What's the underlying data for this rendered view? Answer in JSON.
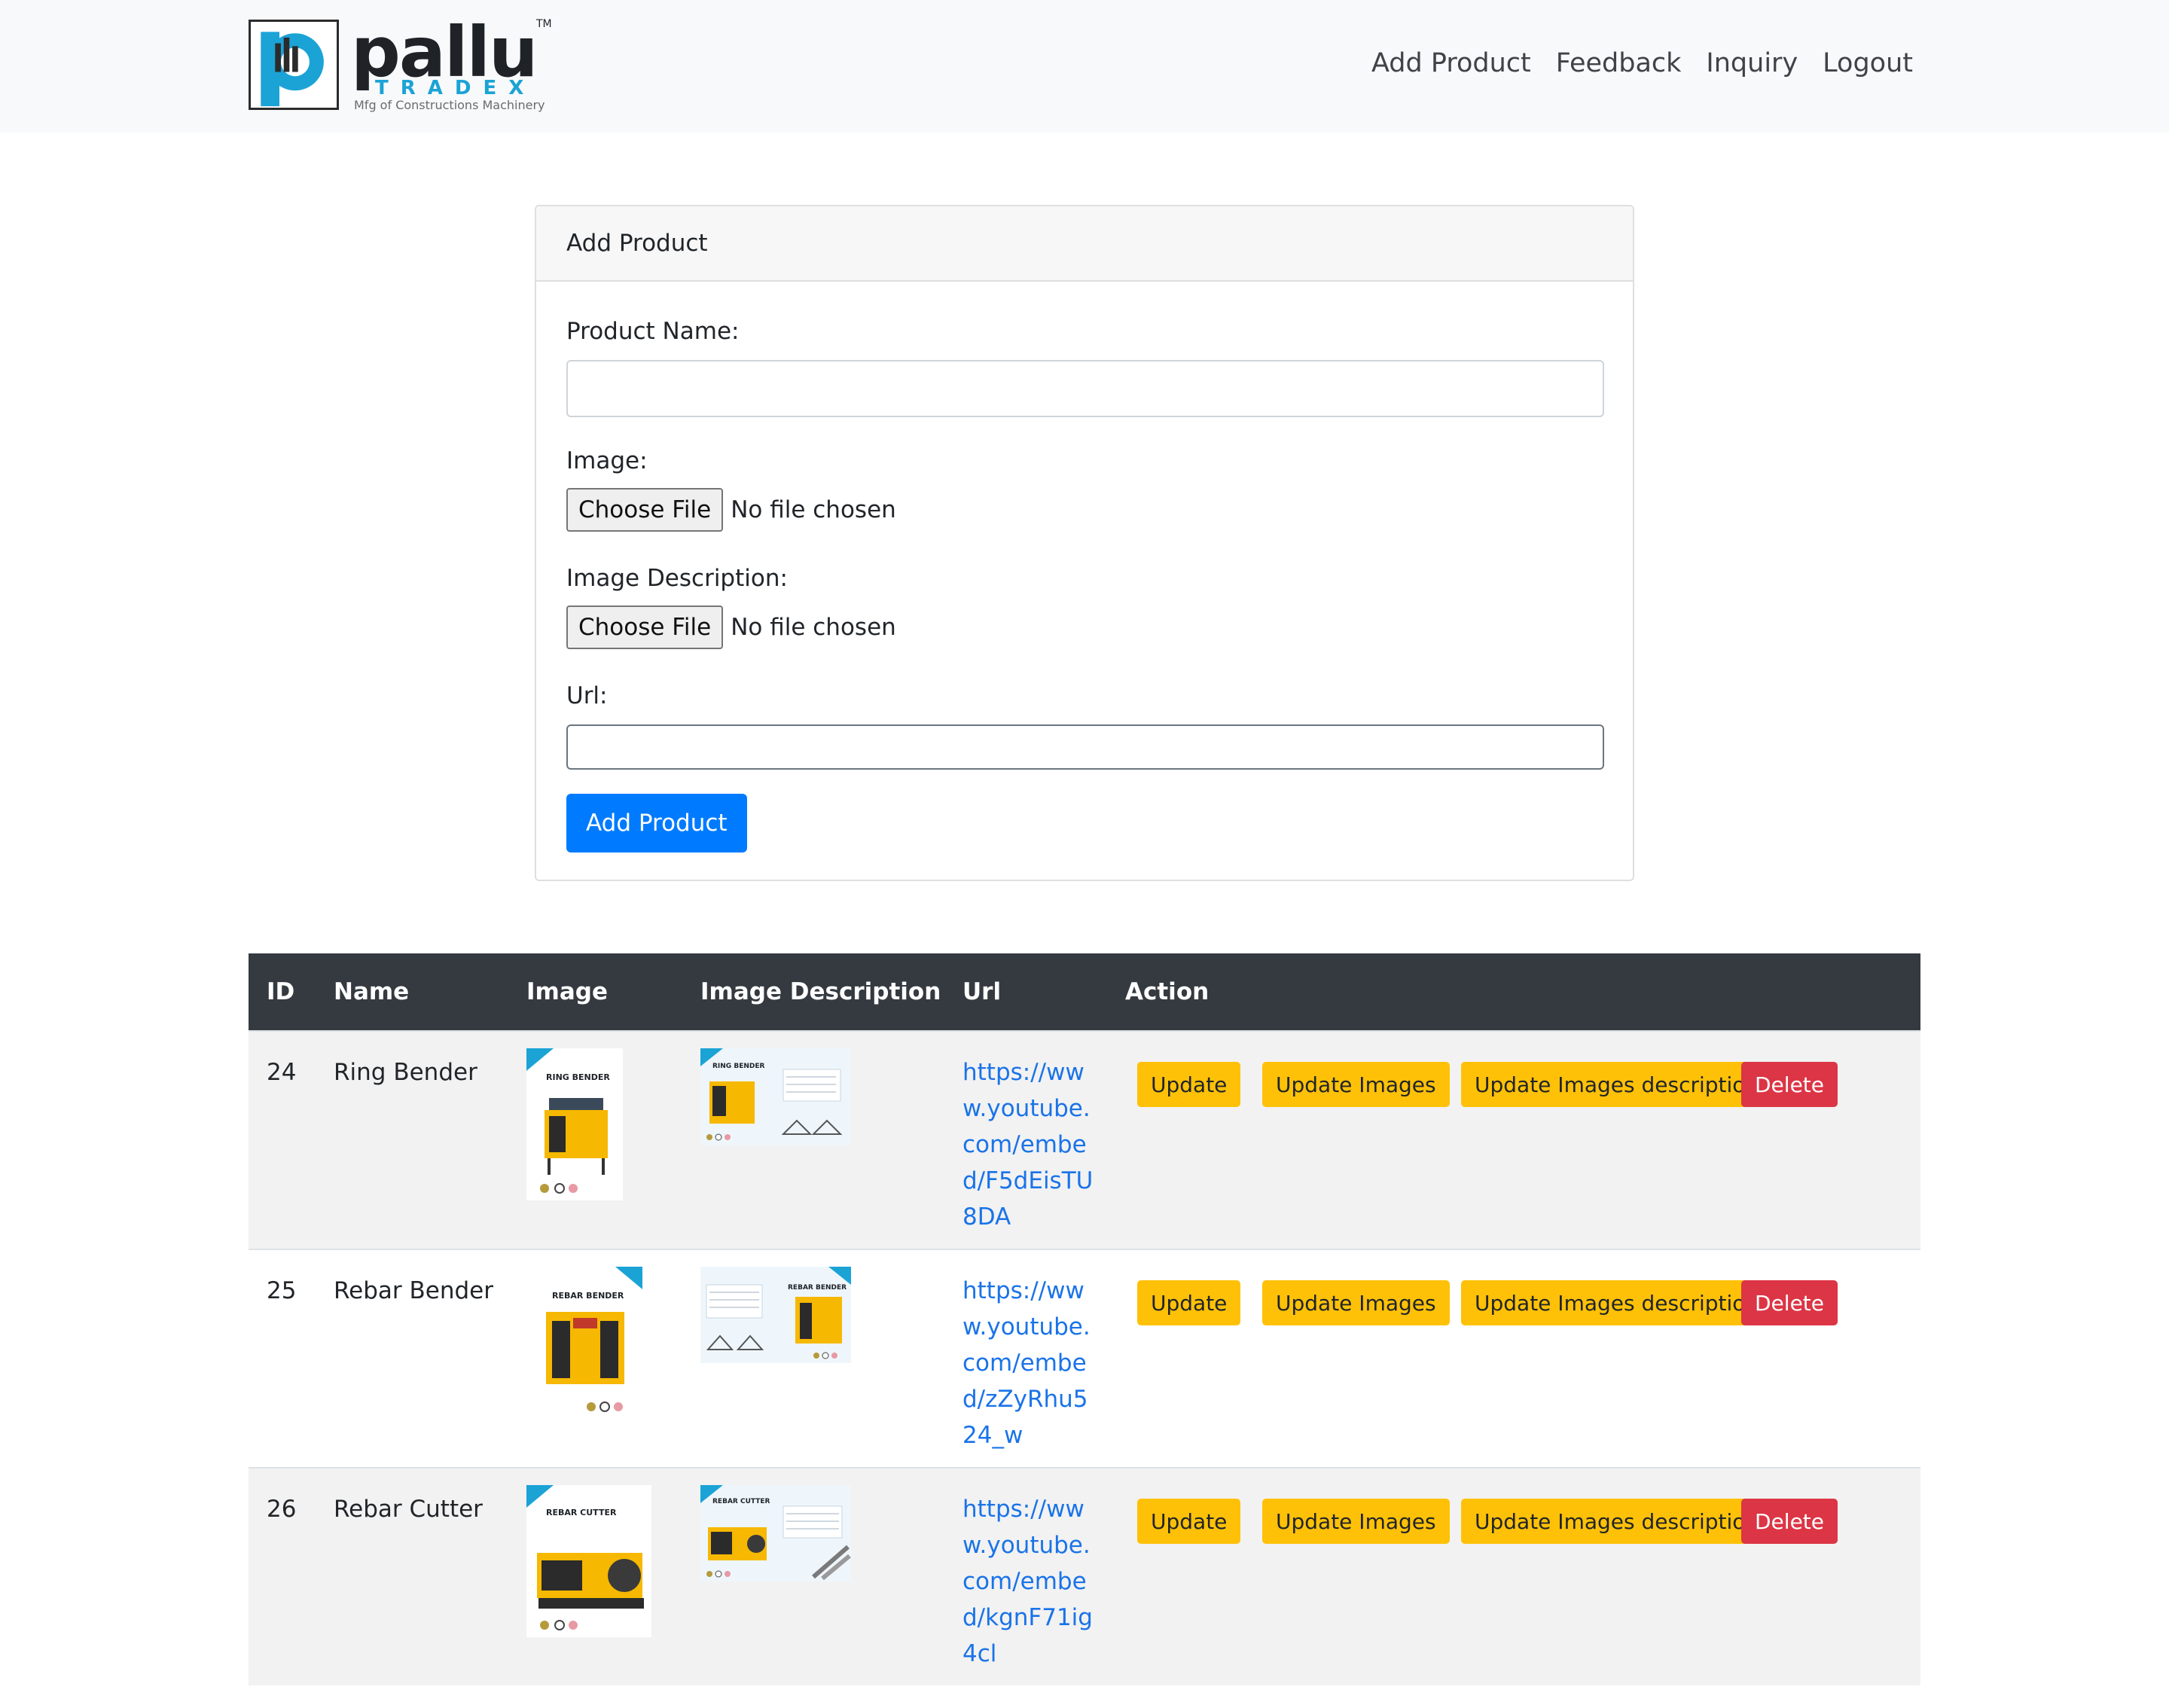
{
  "brand": {
    "name": "pallu",
    "trademark": "TM",
    "sub": "TRADEX",
    "tagline": "Mfg of Constructions Machinery"
  },
  "nav": {
    "items": [
      {
        "label": "Add Product"
      },
      {
        "label": "Feedback"
      },
      {
        "label": "Inquiry"
      },
      {
        "label": "Logout"
      }
    ]
  },
  "form": {
    "header": "Add Product",
    "product_name_label": "Product Name:",
    "product_name_value": "",
    "image_label": "Image:",
    "image_button": "Choose File",
    "image_status": "No file chosen",
    "image_desc_label": "Image Description:",
    "image_desc_button": "Choose File",
    "image_desc_status": "No file chosen",
    "url_label": "Url:",
    "url_value": "",
    "submit_label": "Add Product"
  },
  "table": {
    "headers": [
      "ID",
      "Name",
      "Image",
      "Image Description",
      "Url",
      "Action"
    ],
    "rows": [
      {
        "id": "24",
        "name": "Ring Bender",
        "image_caption": "RING BENDER",
        "desc_caption": "RING BENDER",
        "url": "https://www.youtube.com/embed/F5dEisTU8DA",
        "actions": {
          "update": "Update",
          "update_images": "Update Images",
          "update_desc": "Update Images description",
          "delete": "Delete"
        }
      },
      {
        "id": "25",
        "name": "Rebar Bender",
        "image_caption": "REBAR BENDER",
        "desc_caption": "REBAR BENDER",
        "url": "https://www.youtube.com/embed/zZyRhu524_w",
        "actions": {
          "update": "Update",
          "update_images": "Update Images",
          "update_desc": "Update Images description",
          "delete": "Delete"
        }
      },
      {
        "id": "26",
        "name": "Rebar Cutter",
        "image_caption": "REBAR CUTTER",
        "desc_caption": "REBAR CUTTER",
        "url": "https://www.youtube.com/embed/kgnF71ig4cl",
        "actions": {
          "update": "Update",
          "update_images": "Update Images",
          "update_desc": "Update Images description",
          "delete": "Delete"
        }
      }
    ]
  },
  "colors": {
    "primary": "#007bff",
    "warning": "#ffc107",
    "danger": "#dc3545",
    "table_head": "#343a40",
    "link": "#1a73e8",
    "brand_blue": "#1ba3d6",
    "machine_yellow": "#f6b800"
  }
}
